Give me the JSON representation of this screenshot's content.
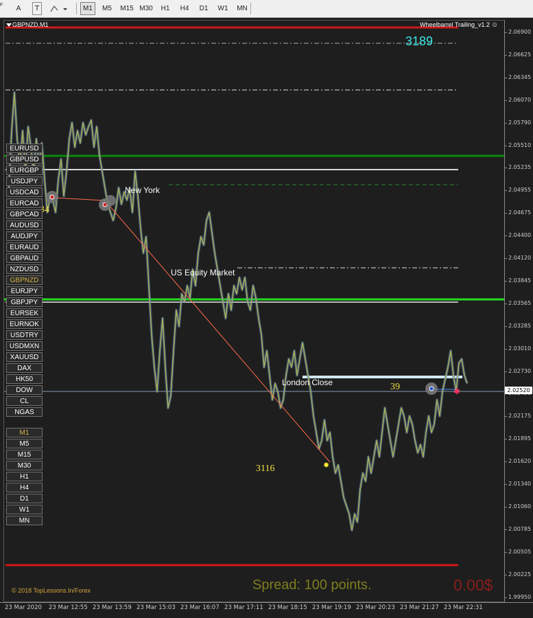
{
  "toolbar": {
    "tool_letter": "A",
    "tool_text": "T",
    "timeframes": [
      {
        "label": "M1",
        "active": true
      },
      {
        "label": "M5",
        "active": false
      },
      {
        "label": "M15",
        "active": false
      },
      {
        "label": "M30",
        "active": false
      },
      {
        "label": "H1",
        "active": false
      },
      {
        "label": "H4",
        "active": false
      },
      {
        "label": "D1",
        "active": false
      },
      {
        "label": "W1",
        "active": false
      },
      {
        "label": "MN",
        "active": false
      }
    ]
  },
  "chart": {
    "title": "GBPNZD,M1",
    "ea_name": "Wheelbarrel Trailing_v1.2",
    "ea_smile": "☺",
    "big_number": "3189",
    "spread": "Spread: 100 points.",
    "profit": "0.00$",
    "copyright": "© 2018 TopLessons.In/Forex",
    "session_labels": {
      "new_york": "New York",
      "us_equity": "US Equity Market",
      "london_close": "London Close"
    },
    "number_labels": {
      "left": "34",
      "right": "39",
      "bottom": "3116"
    },
    "current_price": "2.02520",
    "price_ticks": [
      "2.06900",
      "2.06625",
      "2.06345",
      "2.06070",
      "2.05790",
      "2.05510",
      "2.05235",
      "2.04955",
      "2.04675",
      "2.04400",
      "2.04120",
      "2.03845",
      "2.03565",
      "2.03285",
      "2.03010",
      "2.02730",
      "2.02450",
      "2.02175",
      "2.01895",
      "2.01620",
      "2.01340",
      "2.01060",
      "2.00785",
      "2.00505",
      "2.00225",
      "1.99950"
    ],
    "time_ticks": [
      "23 Mar 2020",
      "23 Mar 12:55",
      "23 Mar 13:59",
      "23 Mar 15:03",
      "23 Mar 16:07",
      "23 Mar 17:11",
      "23 Mar 18:15",
      "23 Mar 19:19",
      "23 Mar 20:23",
      "23 Mar 21:27",
      "23 Mar 22:31"
    ]
  },
  "symbols": [
    "EURUSD",
    "GBPUSD",
    "EURGBP",
    "USDJPY",
    "USDCAD",
    "EURCAD",
    "GBPCAD",
    "AUDUSD",
    "AUDJPY",
    "EURAUD",
    "GBPAUD",
    "NZDUSD",
    "GBPNZD",
    "EURJPY",
    "GBPJPY",
    "EURSEK",
    "EURNOK",
    "USDTRY",
    "USDMXN",
    "XAUUSD",
    "DAX",
    "HK50",
    "DOW",
    "CL",
    "NGAS"
  ],
  "selected_symbol": "GBPNZD",
  "timeframe_buttons": [
    "M1",
    "M5",
    "M15",
    "M30",
    "H1",
    "H4",
    "D1",
    "W1",
    "MN"
  ],
  "selected_timeframe": "M1",
  "chart_data": {
    "type": "line",
    "y_range": [
      1.9995,
      2.0705
    ],
    "close_path": [
      [
        0,
        2.05
      ],
      [
        4,
        2.057
      ],
      [
        8,
        2.0617
      ],
      [
        12,
        2.056
      ],
      [
        16,
        2.053
      ],
      [
        20,
        2.057
      ],
      [
        24,
        2.052
      ],
      [
        28,
        2.0575
      ],
      [
        32,
        2.055
      ],
      [
        36,
        2.052
      ],
      [
        40,
        2.056
      ],
      [
        44,
        2.053
      ],
      [
        48,
        2.0555
      ],
      [
        52,
        2.051
      ],
      [
        56,
        2.047
      ],
      [
        60,
        2.049
      ],
      [
        64,
        2.0485
      ],
      [
        68,
        2.047
      ],
      [
        72,
        2.051
      ],
      [
        76,
        2.0535
      ],
      [
        80,
        2.049
      ],
      [
        84,
        2.052
      ],
      [
        88,
        2.056
      ],
      [
        92,
        2.058
      ],
      [
        96,
        2.055
      ],
      [
        100,
        2.057
      ],
      [
        104,
        2.0555
      ],
      [
        108,
        2.058
      ],
      [
        112,
        2.0565
      ],
      [
        116,
        2.0575
      ],
      [
        120,
        2.0583
      ],
      [
        124,
        2.055
      ],
      [
        128,
        2.0575
      ],
      [
        132,
        2.054
      ],
      [
        136,
        2.052
      ],
      [
        140,
        2.05
      ],
      [
        144,
        2.048
      ],
      [
        148,
        2.047
      ],
      [
        152,
        2.046
      ],
      [
        156,
        2.0475
      ],
      [
        160,
        2.05
      ],
      [
        164,
        2.048
      ],
      [
        168,
        2.0495
      ],
      [
        172,
        2.0485
      ],
      [
        176,
        2.05
      ],
      [
        180,
        2.047
      ],
      [
        184,
        2.052
      ],
      [
        188,
        2.049
      ],
      [
        192,
        2.045
      ],
      [
        196,
        2.042
      ],
      [
        200,
        2.044
      ],
      [
        204,
        2.038
      ],
      [
        208,
        2.032
      ],
      [
        212,
        2.028
      ],
      [
        216,
        2.025
      ],
      [
        220,
        2.03
      ],
      [
        224,
        2.034
      ],
      [
        228,
        2.028
      ],
      [
        232,
        2.023
      ],
      [
        236,
        2.0245
      ],
      [
        240,
        2.03
      ],
      [
        244,
        2.035
      ],
      [
        248,
        2.033
      ],
      [
        252,
        2.037
      ],
      [
        256,
        2.036
      ],
      [
        260,
        2.038
      ],
      [
        264,
        2.0365
      ],
      [
        268,
        2.04
      ],
      [
        272,
        2.038
      ],
      [
        276,
        2.042
      ],
      [
        280,
        2.044
      ],
      [
        284,
        2.043
      ],
      [
        288,
        2.046
      ],
      [
        292,
        2.047
      ],
      [
        296,
        2.0445
      ],
      [
        300,
        2.042
      ],
      [
        304,
        2.04
      ],
      [
        308,
        2.038
      ],
      [
        312,
        2.036
      ],
      [
        316,
        2.034
      ],
      [
        320,
        2.037
      ],
      [
        324,
        2.035
      ],
      [
        328,
        2.038
      ],
      [
        332,
        2.037
      ],
      [
        336,
        2.039
      ],
      [
        340,
        2.0375
      ],
      [
        344,
        2.039
      ],
      [
        348,
        2.036
      ],
      [
        352,
        2.035
      ],
      [
        356,
        2.038
      ],
      [
        360,
        2.0365
      ],
      [
        364,
        2.034
      ],
      [
        368,
        2.032
      ],
      [
        372,
        2.028
      ],
      [
        376,
        2.03
      ],
      [
        380,
        2.027
      ],
      [
        384,
        2.024
      ],
      [
        388,
        2.026
      ],
      [
        392,
        2.025
      ],
      [
        396,
        2.023
      ],
      [
        400,
        2.024
      ],
      [
        404,
        2.027
      ],
      [
        408,
        2.029
      ],
      [
        412,
        2.028
      ],
      [
        416,
        2.03
      ],
      [
        420,
        2.027
      ],
      [
        424,
        2.029
      ],
      [
        428,
        2.031
      ],
      [
        432,
        2.029
      ],
      [
        436,
        2.027
      ],
      [
        440,
        2.025
      ],
      [
        444,
        2.022
      ],
      [
        448,
        2.02
      ],
      [
        452,
        2.018
      ],
      [
        456,
        2.019
      ],
      [
        460,
        2.0215
      ],
      [
        464,
        2.019
      ],
      [
        468,
        2.02
      ],
      [
        472,
        2.017
      ],
      [
        476,
        2.015
      ],
      [
        480,
        2.016
      ],
      [
        484,
        2.014
      ],
      [
        488,
        2.012
      ],
      [
        492,
        2.011
      ],
      [
        496,
        2.01
      ],
      [
        500,
        2.008
      ],
      [
        504,
        2.01
      ],
      [
        508,
        2.009
      ],
      [
        512,
        2.013
      ],
      [
        516,
        2.015
      ],
      [
        520,
        2.014
      ],
      [
        524,
        2.017
      ],
      [
        528,
        2.015
      ],
      [
        532,
        2.017
      ],
      [
        536,
        2.019
      ],
      [
        540,
        2.017
      ],
      [
        544,
        2.02
      ],
      [
        548,
        2.023
      ],
      [
        552,
        2.021
      ],
      [
        556,
        2.019
      ],
      [
        560,
        2.017
      ],
      [
        564,
        2.019
      ],
      [
        568,
        2.021
      ],
      [
        572,
        2.023
      ],
      [
        576,
        2.022
      ],
      [
        580,
        2.02
      ],
      [
        584,
        2.022
      ],
      [
        588,
        2.021
      ],
      [
        592,
        2.019
      ],
      [
        596,
        2.0175
      ],
      [
        600,
        2.0185
      ],
      [
        604,
        2.017
      ],
      [
        608,
        2.02
      ],
      [
        612,
        2.022
      ],
      [
        616,
        2.02
      ],
      [
        620,
        2.021
      ],
      [
        624,
        2.024
      ],
      [
        628,
        2.022
      ],
      [
        632,
        2.025
      ],
      [
        636,
        2.0265
      ],
      [
        640,
        2.028
      ],
      [
        644,
        2.03
      ],
      [
        648,
        2.027
      ],
      [
        652,
        2.025
      ],
      [
        656,
        2.0285
      ],
      [
        660,
        2.029
      ],
      [
        664,
        2.027
      ],
      [
        668,
        2.026
      ]
    ]
  }
}
